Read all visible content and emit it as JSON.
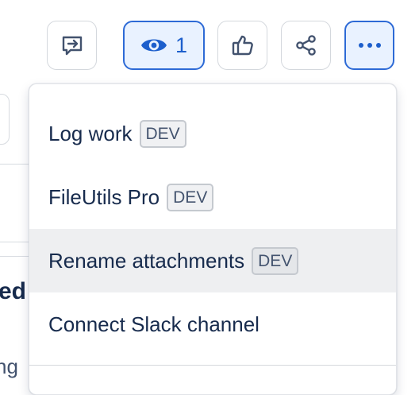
{
  "toolbar": {
    "watchers_count": "1",
    "buttons": [
      {
        "icon": "feedback-icon"
      },
      {
        "icon": "eye-icon"
      },
      {
        "icon": "thumbs-up-icon"
      },
      {
        "icon": "share-icon"
      },
      {
        "icon": "more-icon"
      }
    ],
    "accent_color": "#2d6ad6"
  },
  "background": {
    "heading_fragment": "ed f",
    "text_fragment": "ng"
  },
  "menu": {
    "items": [
      {
        "label": "Log work",
        "badge": "DEV"
      },
      {
        "label": "FileUtils Pro",
        "badge": "DEV"
      },
      {
        "label": "Rename attachments",
        "badge": "DEV",
        "hovered": true
      },
      {
        "label": "Connect Slack channel"
      }
    ]
  }
}
